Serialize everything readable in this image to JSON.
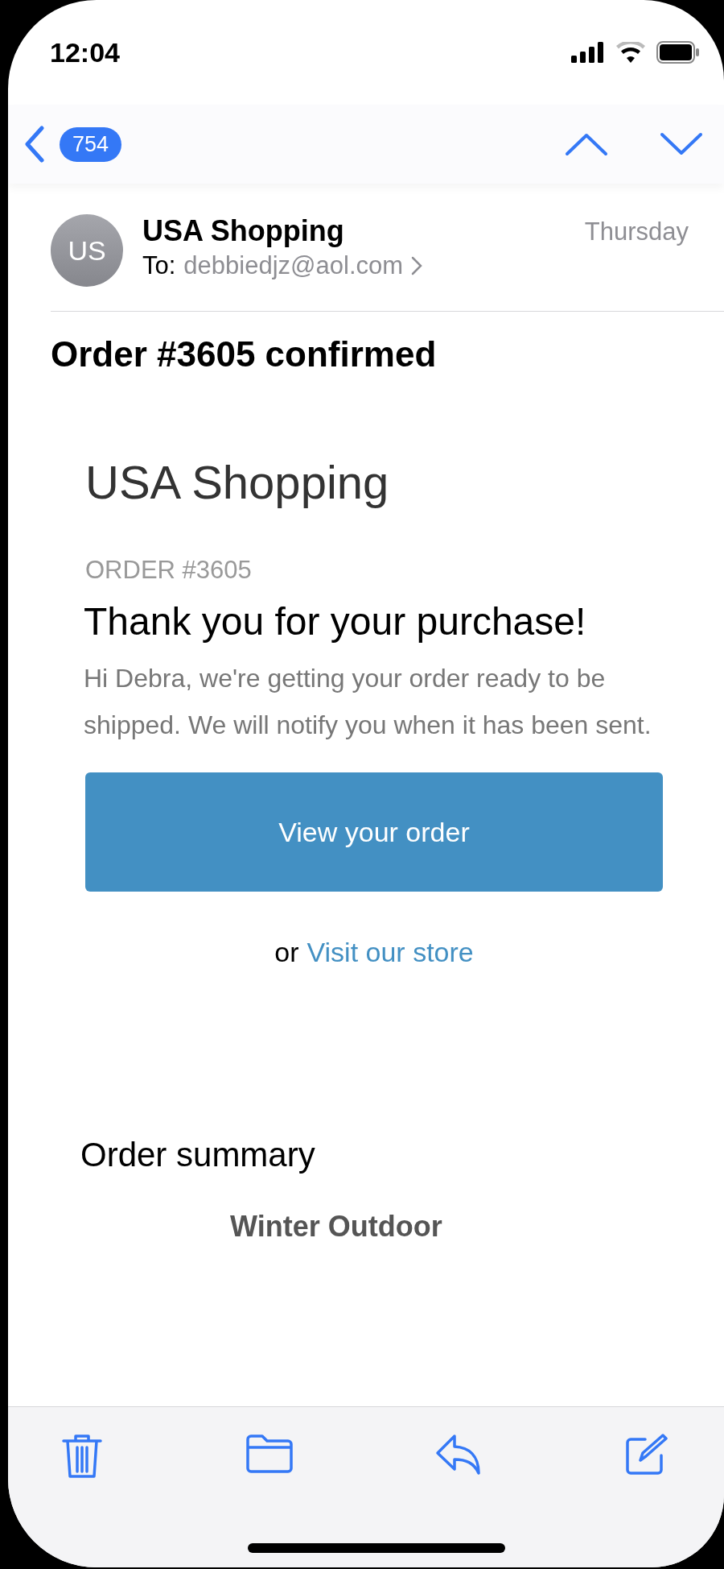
{
  "status_bar": {
    "time": "12:04"
  },
  "nav": {
    "unread_count": "754"
  },
  "message": {
    "avatar_initials": "US",
    "sender": "USA Shopping",
    "to_label": "To:",
    "to_address": "debbiedjz@aol.com",
    "date": "Thursday",
    "subject": "Order #3605 confirmed"
  },
  "body": {
    "store_name": "USA Shopping",
    "order_label": "ORDER #3605",
    "heading": "Thank you for your purchase!",
    "paragraph": "Hi Debra, we're getting your order ready to be shipped. We will notify you when it has been sent.",
    "button": "View your order",
    "link_prefix": "or",
    "link": "Visit our store",
    "summary_heading": "Order summary",
    "item_title": "Winter Outdoor"
  }
}
